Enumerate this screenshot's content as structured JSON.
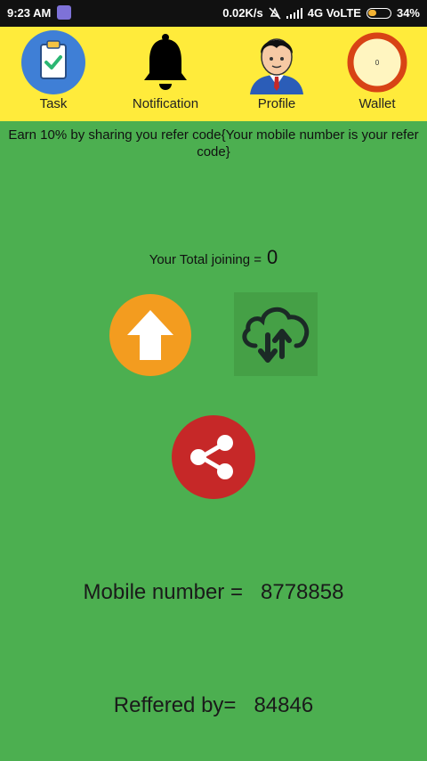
{
  "status_bar": {
    "time": "9:23 AM",
    "net_speed": "0.02K/s",
    "network": "4G VoLTE",
    "battery": "34%"
  },
  "nav": {
    "task_label": "Task",
    "notification_label": "Notification",
    "profile_label": "Profile",
    "wallet_label": "Wallet",
    "wallet_value": "0"
  },
  "refer": {
    "note": "Earn 10% by sharing you refer code{Your mobile number is your refer code}"
  },
  "joining": {
    "label": "Your Total joining =",
    "value": "0"
  },
  "info": {
    "mobile_label": "Mobile number =",
    "mobile_value": "8778858",
    "referred_label": "Reffered by=",
    "referred_value": "84846"
  },
  "colors": {
    "background": "#4caf50",
    "topbar": "#ffeb3b",
    "upload": "#f39c1f",
    "share": "#c62828",
    "wallet_ring": "#d84315"
  },
  "icons": [
    "clipboard-check-icon",
    "bell-icon",
    "profile-avatar-icon",
    "wallet-ring-icon",
    "upload-arrow-icon",
    "cloud-sync-icon",
    "share-icon"
  ]
}
